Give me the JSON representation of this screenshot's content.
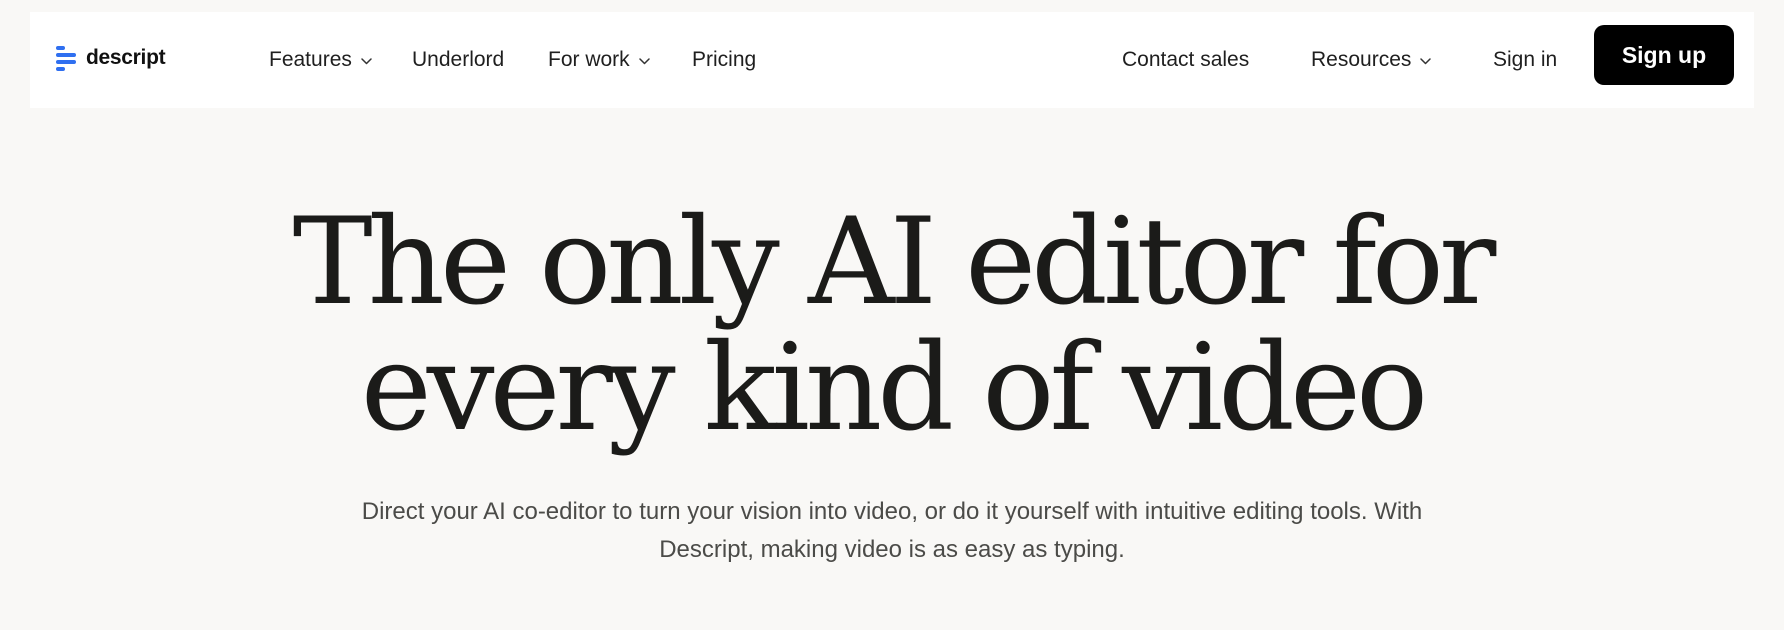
{
  "nav": {
    "logo_text": "descript",
    "items": [
      {
        "label": "Features",
        "has_dropdown": true
      },
      {
        "label": "Underlord",
        "has_dropdown": false
      },
      {
        "label": "For work",
        "has_dropdown": true
      },
      {
        "label": "Pricing",
        "has_dropdown": false
      }
    ],
    "right_items": [
      {
        "label": "Contact sales",
        "has_dropdown": false
      },
      {
        "label": "Resources",
        "has_dropdown": true
      },
      {
        "label": "Sign in",
        "has_dropdown": false
      }
    ],
    "signup_label": "Sign up"
  },
  "hero": {
    "title_line1": "The only AI editor for",
    "title_line2": "every kind of video",
    "subtitle_line1": "Direct your AI co-editor to turn your vision into video, or do it yourself with intuitive editing tools. With",
    "subtitle_line2": "Descript, making video is as easy as typing."
  },
  "colors": {
    "page_background": "#f9f8f6",
    "nav_background": "#ffffff",
    "brand_blue": "#2f6ff0",
    "button_background": "#000000",
    "button_text": "#ffffff"
  },
  "icons": {
    "logo": "descript-logo-icon",
    "dropdown": "chevron-down-icon"
  }
}
